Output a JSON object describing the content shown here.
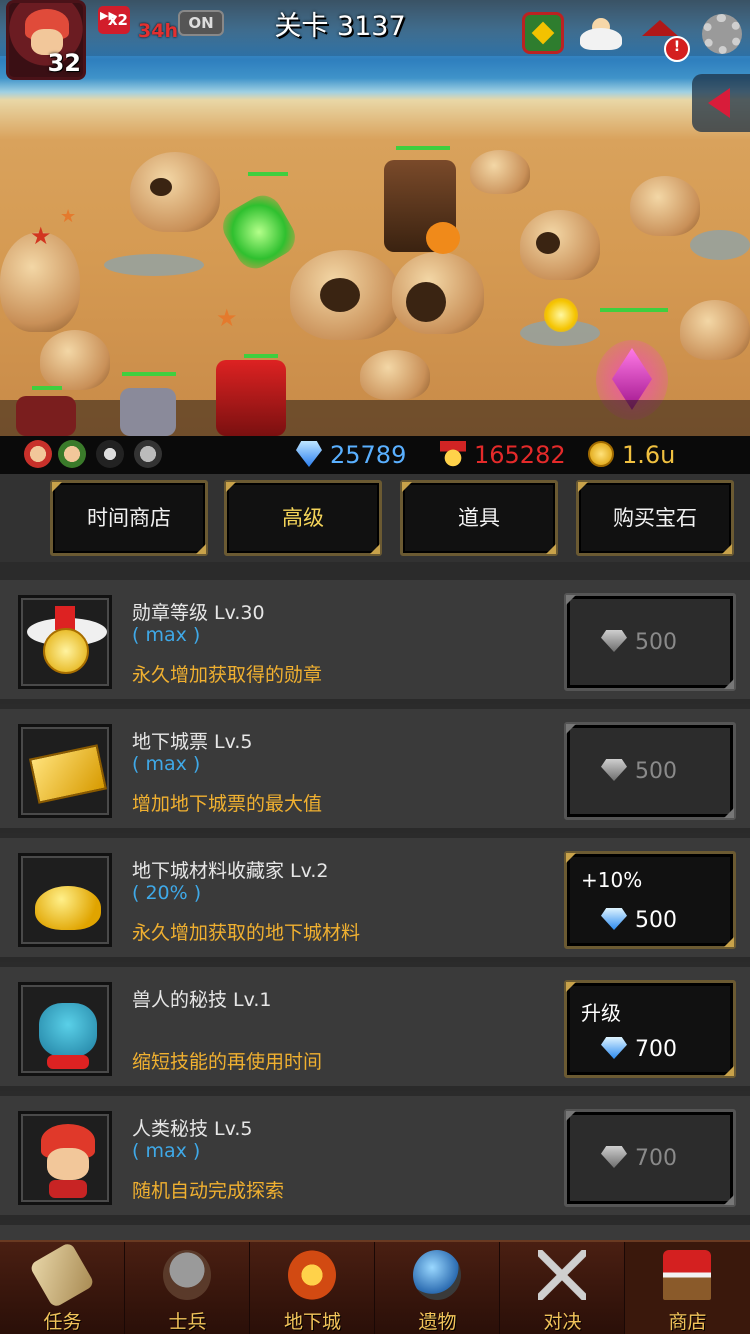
{
  "header": {
    "player_level": "32",
    "speed_badge": "x2",
    "speed_time": "34h",
    "speed_toggle": "ON",
    "stage_title": "关卡 3137"
  },
  "resources": {
    "gems": "25789",
    "medals": "165282",
    "gold": "1.6u"
  },
  "tabs": [
    {
      "label": "时间商店",
      "active": false
    },
    {
      "label": "高级",
      "active": true
    },
    {
      "label": "道具",
      "active": false
    },
    {
      "label": "购买宝石",
      "active": false
    }
  ],
  "items": [
    {
      "title": "勋章等级 Lv.30",
      "sub": "( max )",
      "desc": "永久增加获取得的勋章",
      "button_label": "",
      "price": "500",
      "state": "disabled",
      "icon": "medal-icon"
    },
    {
      "title": "地下城票 Lv.5",
      "sub": "( max )",
      "desc": "增加地下城票的最大值",
      "button_label": "",
      "price": "500",
      "state": "disabled",
      "icon": "ticket-icon"
    },
    {
      "title": "地下城材料收藏家 Lv.2",
      "sub": "( 20% )",
      "desc": "永久增加获取的地下城材料",
      "button_label": "+10%",
      "price": "500",
      "state": "active",
      "icon": "material-pile-icon"
    },
    {
      "title": "兽人的秘技 Lv.1",
      "sub": "",
      "desc": "缩短技能的再使用时间",
      "button_label": "升级",
      "price": "700",
      "state": "active",
      "icon": "orc-icon"
    },
    {
      "title": "人类秘技 Lv.5",
      "sub": "( max )",
      "desc": "随机自动完成探索",
      "button_label": "",
      "price": "700",
      "state": "disabled",
      "icon": "human-icon"
    }
  ],
  "nav": [
    {
      "label": "任务",
      "icon": "scroll-icon",
      "active": false
    },
    {
      "label": "士兵",
      "icon": "soldier-icon",
      "active": false
    },
    {
      "label": "地下城",
      "icon": "dungeon-icon",
      "active": false
    },
    {
      "label": "遗物",
      "icon": "relic-icon",
      "active": false
    },
    {
      "label": "对决",
      "icon": "crossed-swords-icon",
      "active": false
    },
    {
      "label": "商店",
      "icon": "shop-icon",
      "active": true
    }
  ],
  "colors": {
    "gem_blue": "#5ab0ff",
    "medal_red": "#e42a2a",
    "gold_yellow": "#f0c040",
    "desc_orange": "#f0b030",
    "sub_blue": "#3fa9e8",
    "active_tab": "#f5d55a"
  }
}
